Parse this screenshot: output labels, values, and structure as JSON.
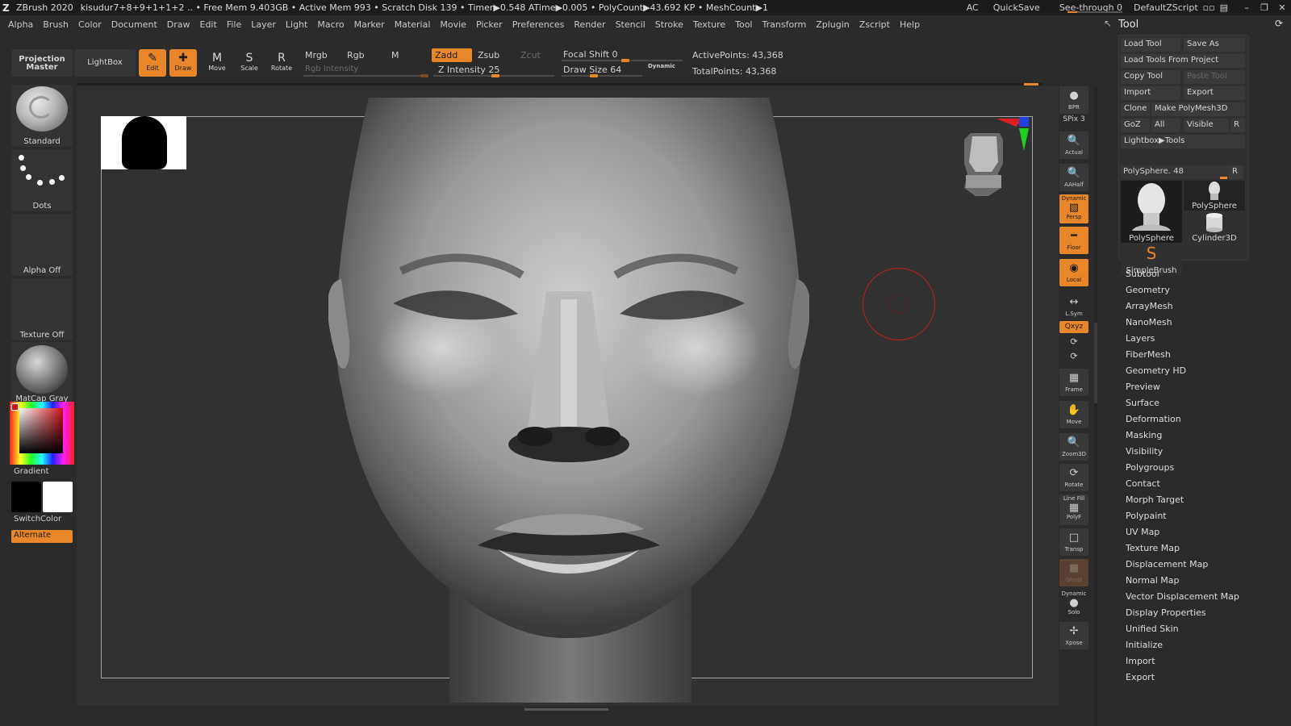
{
  "titlebar": {
    "app": "ZBrush 2020",
    "info": "kisudur7+8+9+1+1+2  .. • Free Mem 9.403GB • Active Mem 993 • Scratch Disk 139 •  Timer▶0.548 ATime▶0.005 • PolyCount▶43.692 KP  • MeshCount▶1",
    "ac": "AC",
    "quicksave": "QuickSave",
    "seethrough": "See-through  0",
    "script": "DefaultZScript"
  },
  "menu": [
    "Alpha",
    "Brush",
    "Color",
    "Document",
    "Draw",
    "Edit",
    "File",
    "Layer",
    "Light",
    "Macro",
    "Marker",
    "Material",
    "Movie",
    "Picker",
    "Preferences",
    "Render",
    "Stencil",
    "Stroke",
    "Texture",
    "Tool",
    "Transform",
    "Zplugin",
    "Zscript",
    "Help"
  ],
  "toolbar": {
    "projection_master": "Projection Master",
    "lightbox": "LightBox",
    "edit": "Edit",
    "draw": "Draw",
    "move": "Move",
    "scale": "Scale",
    "rotate": "Rotate",
    "mrgb": "Mrgb",
    "rgb": "Rgb",
    "m": "M",
    "rgb_intensity": "Rgb Intensity",
    "zadd": "Zadd",
    "zsub": "Zsub",
    "zcut": "Zcut",
    "z_intensity": "Z Intensity 25",
    "focal_shift": "Focal Shift 0",
    "draw_size": "Draw Size 64",
    "dynamic": "Dynamic",
    "active_points": "ActivePoints: 43,368",
    "total_points": "TotalPoints: 43,368"
  },
  "leftshelf": {
    "brush": "Standard",
    "stroke": "Dots",
    "alpha": "Alpha Off",
    "texture": "Texture Off",
    "material": "MatCap Gray",
    "gradient": "Gradient",
    "switchcolor": "SwitchColor",
    "alternate": "Alternate",
    "colors": {
      "main": "#d10f1a",
      "secondary_dark": "#000000",
      "secondary_light": "#ffffff"
    }
  },
  "rightshelf": {
    "bpr": "BPR",
    "spix": "SPix 3",
    "actual": "Actual",
    "aahalf": "AAHalf",
    "persp": "Persp",
    "persp_top": "Dynamic",
    "floor": "Floor",
    "local": "Local",
    "lsym": "L.Sym",
    "xyz": "Qxyz",
    "frame": "Frame",
    "move": "Move",
    "zoom3d": "Zoom3D",
    "rotate": "Rotate",
    "polyf": "PolyF",
    "polyf_top": "Line Fill",
    "transp": "Transp",
    "ghost": "Ghost",
    "solo": "Solo",
    "solo_top": "Dynamic",
    "xpose": "Xpose"
  },
  "toolpanel": {
    "title": "Tool",
    "load_tool": "Load Tool",
    "save_as": "Save As",
    "load_from_project": "Load Tools From Project",
    "copy_tool": "Copy Tool",
    "paste_tool": "Paste Tool",
    "import": "Import",
    "export": "Export",
    "clone": "Clone",
    "make_polymesh": "Make PolyMesh3D",
    "goz": "GoZ",
    "all": "All",
    "visible": "Visible",
    "r": "R",
    "lightbox_tools": "Lightbox▶Tools",
    "polysphere_slider": "PolySphere. 48",
    "tiles": [
      "PolySphere",
      "PolySphere",
      "Cylinder3D",
      "SimpleBrush"
    ],
    "subpalettes": [
      "Subtool",
      "Geometry",
      "ArrayMesh",
      "NanoMesh",
      "Layers",
      "FiberMesh",
      "Geometry HD",
      "Preview",
      "Surface",
      "Deformation",
      "Masking",
      "Visibility",
      "Polygroups",
      "Contact",
      "Morph Target",
      "Polypaint",
      "UV Map",
      "Texture Map",
      "Displacement Map",
      "Normal Map",
      "Vector Displacement Map",
      "Display Properties",
      "Unified Skin",
      "Initialize",
      "Import",
      "Export"
    ]
  }
}
